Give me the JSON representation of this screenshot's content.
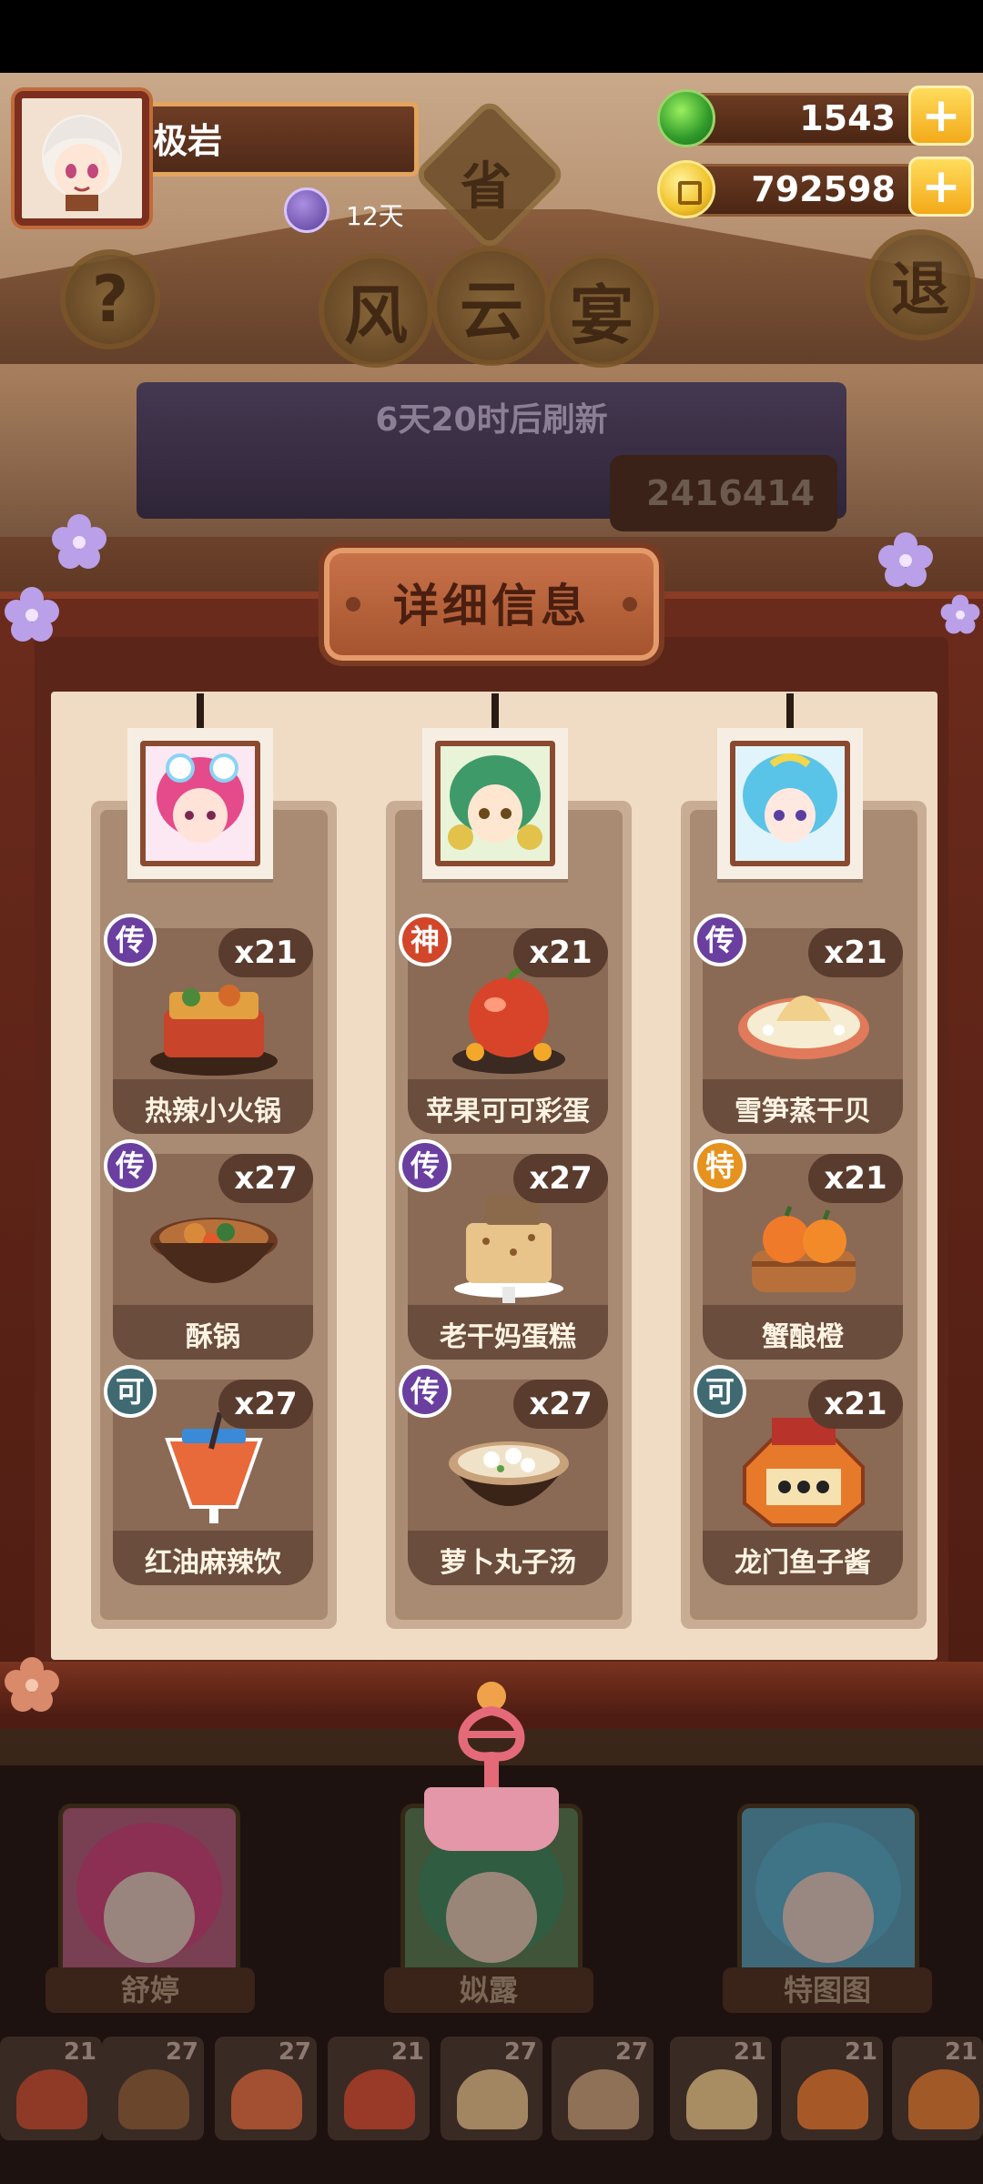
{
  "player": {
    "name": "极岩",
    "days_label": "12天"
  },
  "resources": {
    "jade": "1543",
    "coins": "792598"
  },
  "event": {
    "province_char": "省",
    "title_chars": [
      "风",
      "云",
      "宴"
    ],
    "refresh_text": "6天20时后刷新",
    "score_partial": "2416414",
    "help_char": "?",
    "exit_char": "退"
  },
  "panel": {
    "title": "详细信息",
    "columns": [
      {
        "character": "舒婷",
        "dishes": [
          {
            "rarity": "传",
            "name": "热辣小火锅",
            "qty": "x21"
          },
          {
            "rarity": "传",
            "name": "酥锅",
            "qty": "x27"
          },
          {
            "rarity": "可",
            "name": "红油麻辣饮",
            "qty": "x27"
          }
        ]
      },
      {
        "character": "姒露",
        "dishes": [
          {
            "rarity": "神",
            "name": "苹果可可彩蛋",
            "qty": "x21"
          },
          {
            "rarity": "传",
            "name": "老干妈蛋糕",
            "qty": "x27"
          },
          {
            "rarity": "传",
            "name": "萝卜丸子汤",
            "qty": "x27"
          }
        ]
      },
      {
        "character": "特图图",
        "dishes": [
          {
            "rarity": "传",
            "name": "雪笋蒸干贝",
            "qty": "x21"
          },
          {
            "rarity": "特",
            "name": "蟹酿橙",
            "qty": "x21"
          },
          {
            "rarity": "可",
            "name": "龙门鱼子酱",
            "qty": "x21"
          }
        ]
      }
    ]
  },
  "bottom_characters": [
    "舒婷",
    "姒露",
    "特图图"
  ],
  "mini_dishes": [
    "21",
    "27",
    "27",
    "21",
    "27",
    "27",
    "21",
    "21",
    "21"
  ],
  "colors": {
    "rarity_legend": "#6a3fa0",
    "rarity_god": "#d2462a",
    "rarity_special": "#e6921e",
    "rarity_common": "#3f6a72"
  }
}
